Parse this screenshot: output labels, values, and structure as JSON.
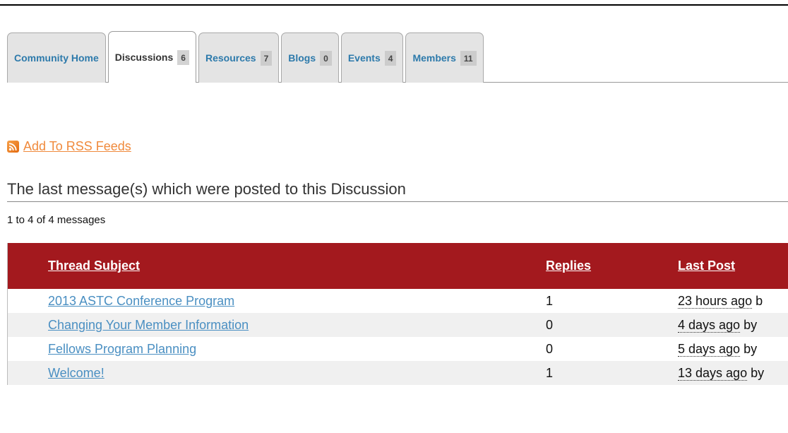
{
  "tabs": [
    {
      "label": "Community Home",
      "count": null,
      "active": false
    },
    {
      "label": "Discussions",
      "count": "6",
      "active": true
    },
    {
      "label": "Resources",
      "count": "7",
      "active": false
    },
    {
      "label": "Blogs",
      "count": "0",
      "active": false
    },
    {
      "label": "Events",
      "count": "4",
      "active": false
    },
    {
      "label": "Members",
      "count": "11",
      "active": false
    }
  ],
  "rss": {
    "label": "Add To RSS Feeds",
    "icon": "rss-icon"
  },
  "section": {
    "title": "The last message(s) which were posted to this Discussion",
    "count_text": "1 to 4 of 4 messages"
  },
  "table": {
    "headers": {
      "subject": "Thread Subject",
      "replies": "Replies",
      "last_post": "Last Post"
    },
    "rows": [
      {
        "subject": "2013 ASTC Conference Program",
        "replies": "1",
        "ago": "23 hours ago",
        "by": " b"
      },
      {
        "subject": "Changing Your Member Information",
        "replies": "0",
        "ago": "4 days ago",
        "by": " by"
      },
      {
        "subject": "Fellows Program Planning",
        "replies": "0",
        "ago": "5 days ago",
        "by": " by"
      },
      {
        "subject": "Welcome!",
        "replies": "1",
        "ago": "13 days ago",
        "by": " by"
      }
    ]
  },
  "colors": {
    "header_bg": "#a3191e",
    "link": "#4a8fc2",
    "rss": "#f08a3c",
    "tab_link": "#2d7aab"
  }
}
